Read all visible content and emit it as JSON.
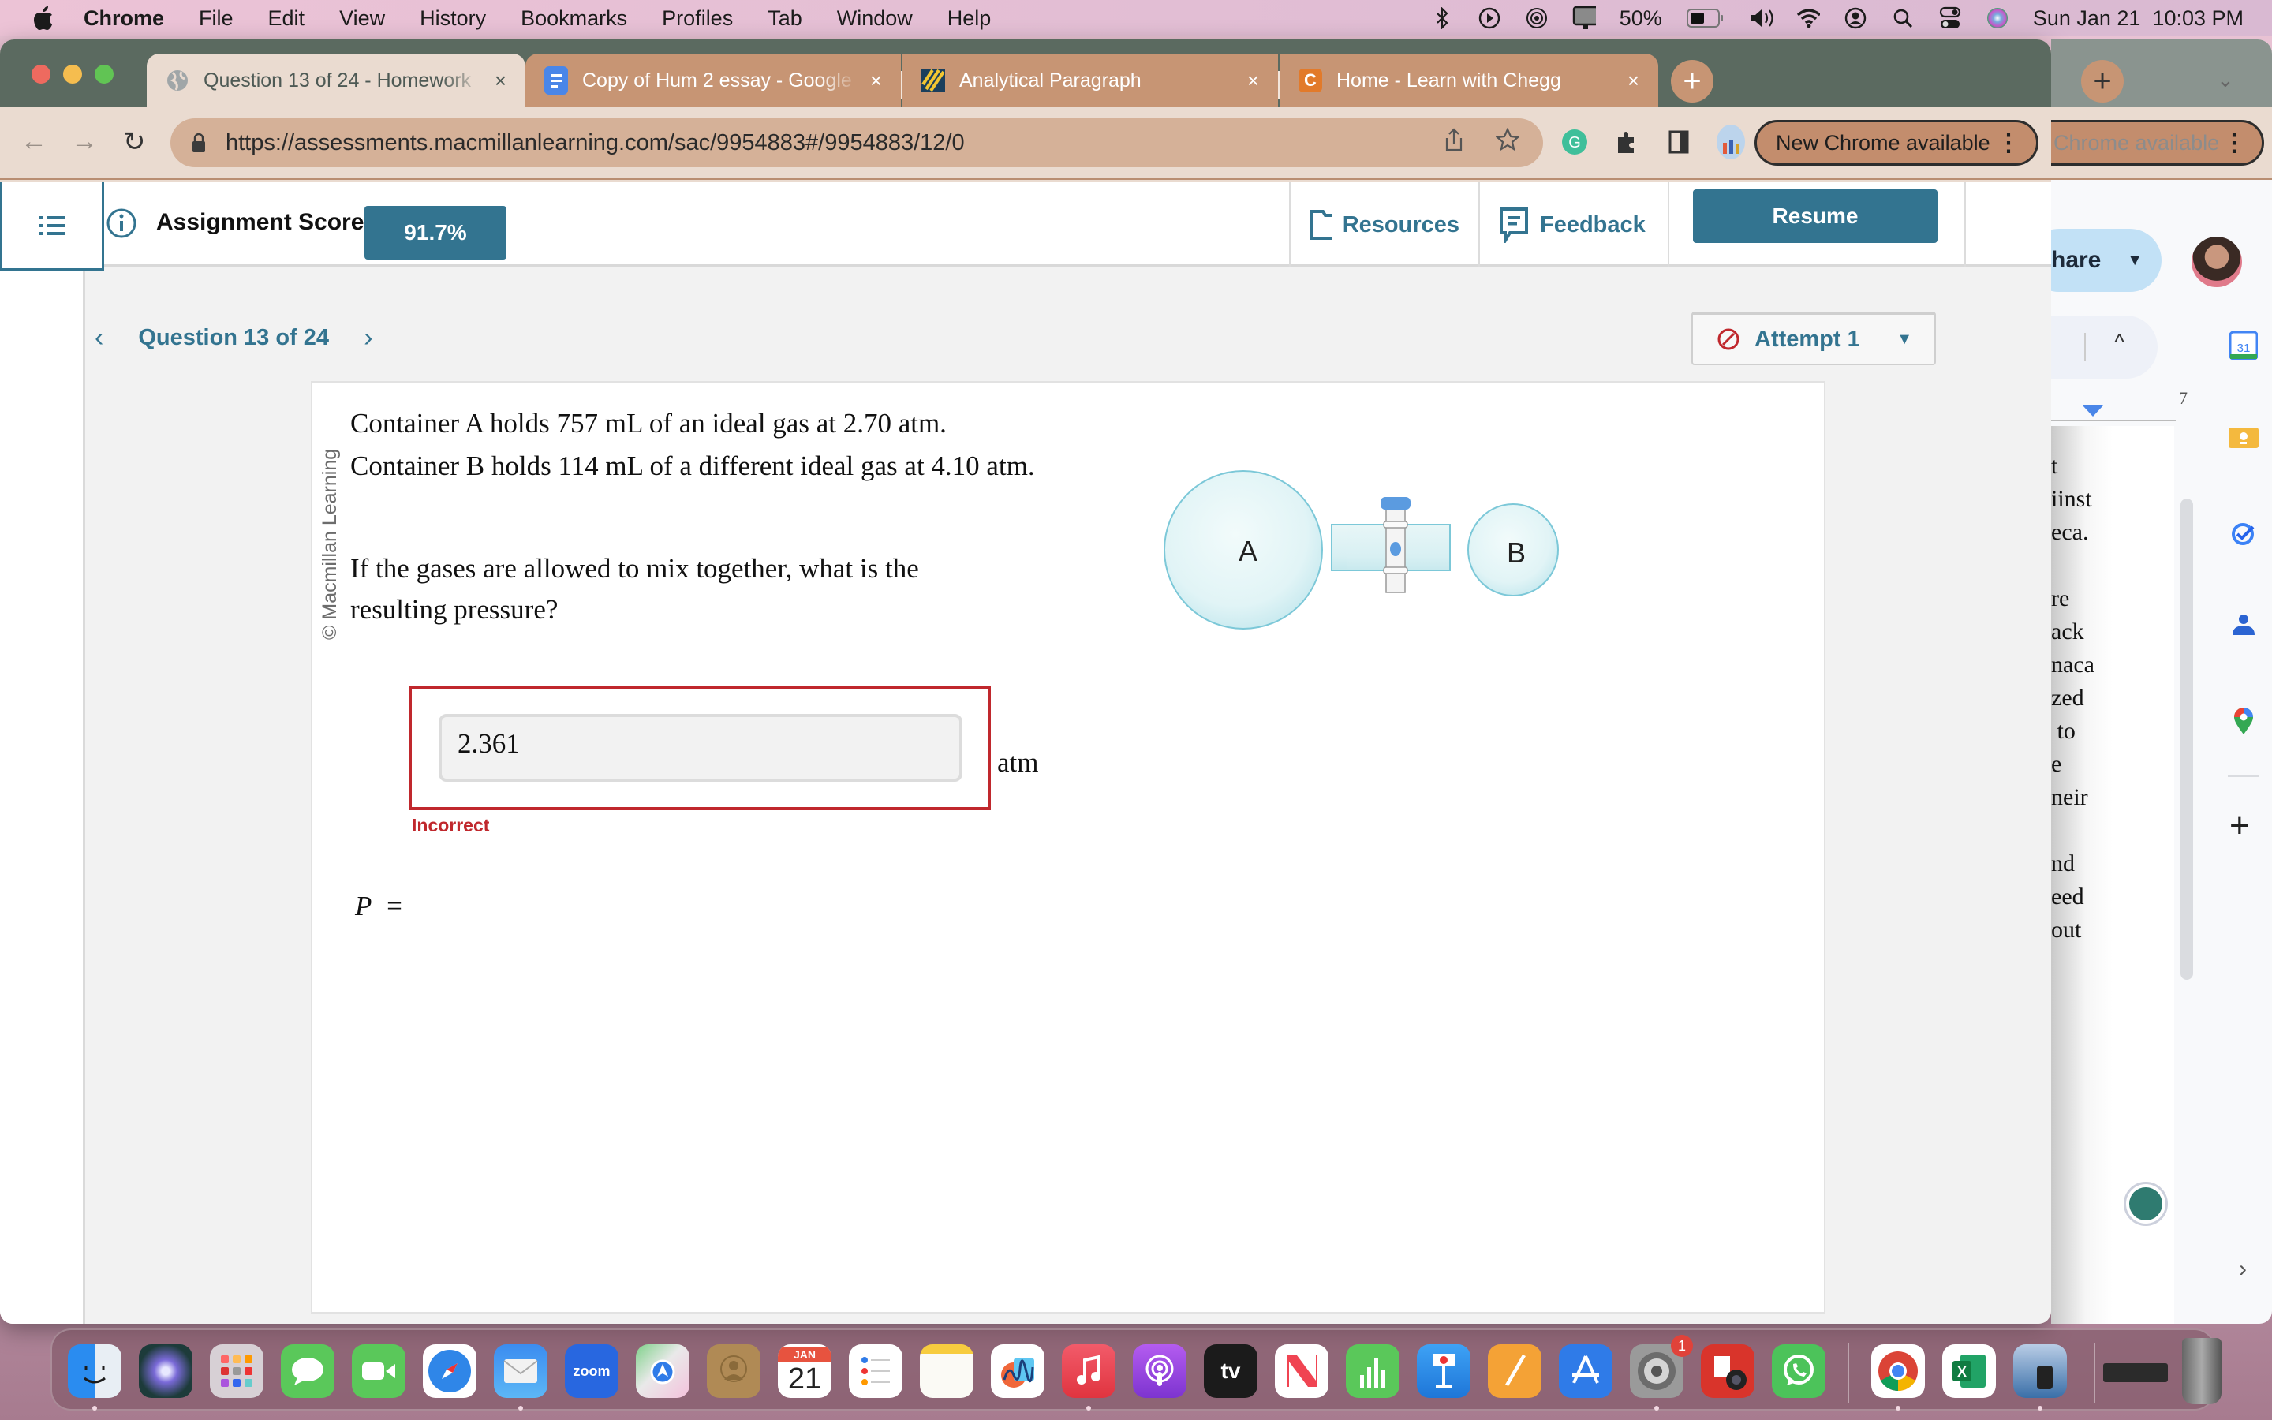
{
  "menubar": {
    "app": "Chrome",
    "items": [
      "File",
      "Edit",
      "View",
      "History",
      "Bookmarks",
      "Profiles",
      "Tab",
      "Window",
      "Help"
    ],
    "battery": "50%",
    "datetime": "Sun Jan 21  10:03 PM",
    "status_icons": [
      "bluetooth-icon",
      "play-icon",
      "airdrop-icon",
      "display-icon",
      "battery-icon",
      "volume-icon",
      "wifi-icon",
      "user-icon",
      "spotlight-icon",
      "control-center-icon",
      "siri-icon"
    ]
  },
  "browser": {
    "tabs": [
      {
        "title": "Question 13 of 24 - Homework",
        "icon": "globe-icon",
        "active": true
      },
      {
        "title": "Copy of Hum 2 essay - Google",
        "icon": "google-docs-icon",
        "active": false
      },
      {
        "title": "Analytical Paragraph",
        "icon": "stripes-icon",
        "active": false
      },
      {
        "title": "Home - Learn with Chegg",
        "icon": "chegg-icon",
        "active": false
      }
    ],
    "close_glyph": "×",
    "newtab_glyph": "+",
    "url_host": "https://assessments.macmillanlearning.com",
    "url_path": "/sac/9954883#/9954883/12/0",
    "update_label": "New Chrome available",
    "update_label_back": "Chrome available"
  },
  "app": {
    "score_label": "Assignment Score:",
    "score_value": "91.7%",
    "resources_label": "Resources",
    "feedback_label": "Feedback",
    "resume_label": "Resume",
    "question_nav": "Question 13 of 24",
    "attempt_label": "Attempt 1"
  },
  "question": {
    "copyright": "© Macmillan Learning",
    "line1": "Container A holds 757 mL of an ideal gas at 2.70 atm.",
    "line2": "Container B holds 114 mL of a different ideal gas at 4.10 atm.",
    "line3": "If the gases are allowed to mix together, what is the",
    "line4": "resulting pressure?",
    "answer_label": "P",
    "equals": "=",
    "answer_value": "2.361",
    "unit": "atm",
    "feedback": "Incorrect",
    "diagram": {
      "label_a": "A",
      "label_b": "B"
    }
  },
  "docpane": {
    "share_label": "hare",
    "ruler_number": "7",
    "lines": [
      "t",
      "iinst",
      "eca.",
      "",
      "re",
      "ack",
      "naca",
      "zed",
      " to",
      "e",
      "neir",
      "",
      "nd",
      "eed",
      "out"
    ]
  },
  "dock": {
    "calendar_month": "JAN",
    "calendar_day": "21",
    "zoom_label": "zoom",
    "tv_label": "tv",
    "settings_badge": "1",
    "excel_label": "X"
  },
  "colors": {
    "brand": "#337490",
    "error": "#c0282d"
  }
}
